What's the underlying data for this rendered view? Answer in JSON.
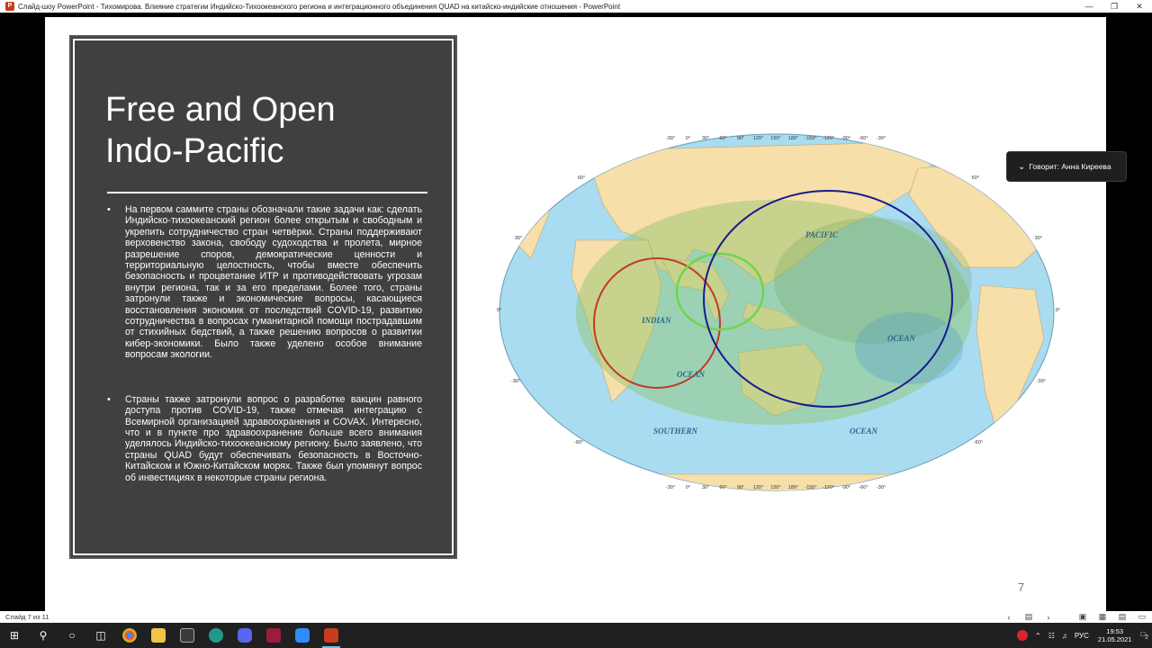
{
  "window": {
    "title": "Слайд-шоу PowerPoint  -  Тихомирова. Влияние стратегии Индийско-Тихоокеанского региона и интеграционного объединения QUAD на китайско-индийские отношения - PowerPoint",
    "app_icon_letter": "P"
  },
  "slide": {
    "title_line1": "Free and Open",
    "title_line2": "Indo-Pacific",
    "bullet1": "На первом саммите страны обозначали такие задачи как: сделать Индийско-тихоокеанский регион более открытым и свободным и укрепить сотрудничество стран четвёрки. Страны поддерживают верховенство закона, свободу судоходства и пролета, мирное разрешение споров, демократические ценности и территориальную целостность, чтобы вместе обеспечить безопасность и процветание ИТР и противодействовать угрозам внутри региона, так и за его пределами. Более того, страны затронули также и экономические вопросы, касающиеся восстановления экономик от последствий COVID-19, развитию сотрудничества в вопросах гуманитарной помощи пострадавшим от стихийных бедствий, а также решению вопросов о развитии кибер-экономики. Было также уделено особое внимание вопросам экологии.",
    "bullet2": "Страны также затронули вопрос о разработке вакцин равного доступа против COVID-19, также отмечая интеграцию с Всемирной организацией здравоохранения и COVAX. Интересно, что и в пункте про здравоохранение больше всего внимания уделялось Индийско-тихоокеанскому региону. Было заявлено, что страны QUAD будут обеспечивать безопасность в Восточно-Китайском и Южно-Китайском морях. Также был упомянут вопрос об инвестициях в некоторые страны региона.",
    "number": "7"
  },
  "map": {
    "labels": {
      "pacific": "PACIFIC",
      "indian": "INDIAN",
      "indian_ocean": "OCEAN",
      "pacific_ocean": "OCEAN",
      "southern": "SOUTHERN",
      "southern_ocean": "OCEAN"
    },
    "top_ticks": [
      "-30°",
      "0°",
      "30°",
      "60°",
      "90°",
      "120°",
      "150°",
      "180°",
      "-150°",
      "-120°",
      "-90°",
      "-60°",
      "-30°"
    ],
    "bottom_ticks": [
      "-30°",
      "0°",
      "30°",
      "60°",
      "90°",
      "120°",
      "150°",
      "180°",
      "-150°",
      "-120°",
      "-90°",
      "-60°",
      "-30°"
    ],
    "lat_left": [
      "60°",
      "30°",
      "0°",
      "-30°",
      "-60°"
    ],
    "lat_right": [
      "60°",
      "30°",
      "0°",
      "-30°",
      "-60°"
    ],
    "colors": {
      "ocean": "#a9dcf0",
      "land": "#f6dfa9",
      "region": "#8fc46a",
      "red_circle": "#c0392b",
      "green_circle": "#6fd64a",
      "blue_circle": "#1a1a8c"
    }
  },
  "toast": {
    "text": "Говорит: Анна Киреева"
  },
  "statusbar": {
    "slide_counter": "Слайд 7 из 11"
  },
  "taskbar": {
    "time": "19:53",
    "date": "21.05.2021",
    "lang": "РУС",
    "notifications": "2"
  }
}
